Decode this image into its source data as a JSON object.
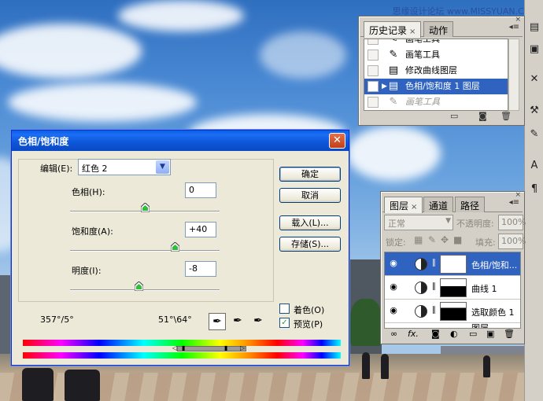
{
  "watermark": "思缘设计论坛 www.MISSYUAN.COM",
  "history": {
    "tabs": [
      {
        "label": "历史记录",
        "close": "×"
      },
      {
        "label": "动作"
      }
    ],
    "items": [
      {
        "label": "画笔工具",
        "icon": "brush-icon",
        "state": "partial"
      },
      {
        "label": "画笔工具",
        "icon": "brush-icon",
        "state": "normal"
      },
      {
        "label": "修改曲线图层",
        "icon": "document-icon",
        "state": "normal"
      },
      {
        "label": "色相/饱和度 1 图层",
        "icon": "document-icon",
        "state": "selected"
      },
      {
        "label": "画笔工具",
        "icon": "brush-icon",
        "state": "dimmed"
      }
    ]
  },
  "layers": {
    "tabs": [
      {
        "label": "图层",
        "close": "×"
      },
      {
        "label": "通道"
      },
      {
        "label": "路径"
      }
    ],
    "blend_mode": "正常",
    "opacity_label": "不透明度:",
    "opacity_value": "100%",
    "lock_label": "锁定:",
    "fill_label": "填充:",
    "fill_value": "100%",
    "items": [
      {
        "name": "色相/饱和...",
        "selected": true,
        "mask": "white"
      },
      {
        "name": "曲线 1",
        "selected": false,
        "mask": "curve"
      },
      {
        "name": "选取颜色 1",
        "selected": false,
        "mask": "selective"
      }
    ],
    "partial_item": "图层..."
  },
  "dialog": {
    "title": "色相/饱和度",
    "edit_label": "编辑(E):",
    "edit_value": "红色 2",
    "hue_label": "色相(H):",
    "hue_value": "0",
    "saturation_label": "饱和度(A):",
    "saturation_value": "+40",
    "lightness_label": "明度(I):",
    "lightness_value": "-8",
    "ok_label": "确定",
    "cancel_label": "取消",
    "load_label": "载入(L)...",
    "save_label": "存储(S)...",
    "colorize_label": "着色(O)",
    "colorize_checked": false,
    "preview_label": "预览(P)",
    "preview_checked": true,
    "range_left": "357°/5°",
    "range_right": "51°\\64°",
    "hue_level": 0.5,
    "saturation_level": 0.7,
    "lightness_level": 0.46
  }
}
